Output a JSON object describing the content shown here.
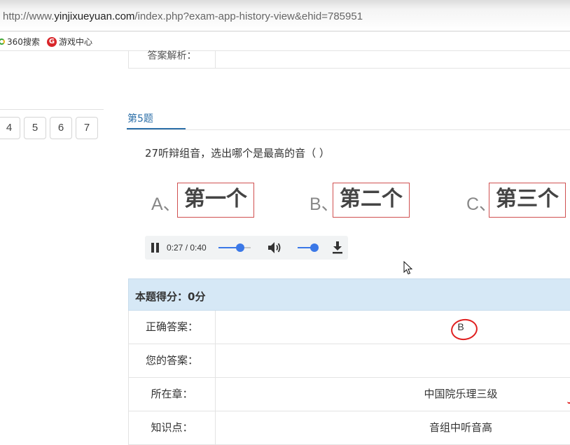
{
  "browser": {
    "url_prefix": "http://www.",
    "url_host": "yinjixueyuan.com",
    "url_path": "/index.php?exam-app-history-view&ehid=785951",
    "bookmarks": [
      {
        "label": "360搜索",
        "icon": "360-search-icon"
      },
      {
        "label": "游戏中心",
        "icon": "game-center-icon"
      }
    ]
  },
  "sidebar": {
    "question_numbers": [
      "4",
      "5",
      "6",
      "7"
    ]
  },
  "previous": {
    "analysis_label": "答案解析："
  },
  "question": {
    "title": "第5题",
    "text": "27听辩组音，选出哪个是最高的音（    ）",
    "options": [
      {
        "letter": "A、",
        "text": "第一个"
      },
      {
        "letter": "B、",
        "text": "第二个"
      },
      {
        "letter": "C、",
        "text": "第三个"
      }
    ]
  },
  "player": {
    "time": "0:27 / 0:40",
    "progress_fraction": 0.675,
    "volume_fraction": 0.8
  },
  "result": {
    "score_label": "本题得分：0分",
    "rows": [
      {
        "key": "正确答案：",
        "value": "B"
      },
      {
        "key": "您的答案：",
        "value": ""
      },
      {
        "key": "所在章：",
        "value": "中国院乐理三级"
      },
      {
        "key": "知识点：",
        "value": "音组中听音高"
      }
    ]
  },
  "colors": {
    "accent": "#2c6fa8",
    "score_header_bg": "#d6e8f6",
    "option_border": "#d05050",
    "annotation_red": "#e02020",
    "player_blue": "#3b78e7"
  }
}
